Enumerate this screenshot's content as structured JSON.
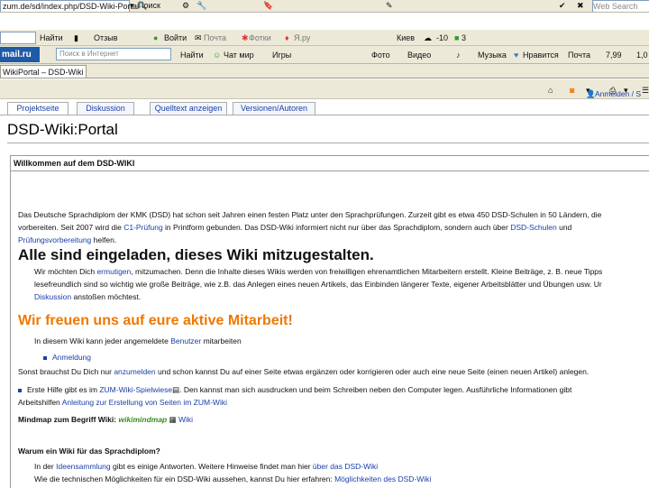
{
  "toolbar1": {
    "address": "zum.de/sd/index.php/DSD-Wiki-Portal",
    "search_label": "Поиск",
    "web_search": "Web Search"
  },
  "toolbar2": {
    "find": "Найти",
    "feedback": "Отзыв",
    "login": "Войти",
    "mail": "Почта",
    "photo": "Фотки",
    "ya": "Я.ру",
    "city": "Киев",
    "weather": "-10",
    "traffic": "3"
  },
  "toolbar3": {
    "brand": "mail.ru",
    "search_placeholder": "Поиск в Интернет",
    "find": "Найти",
    "agent": "Чат мир",
    "games": "Игры",
    "photo": "Фото",
    "video": "Видео",
    "music": "Музыка",
    "like": "Нравится",
    "mail": "Почта",
    "price": "7,99",
    "more": "1,0"
  },
  "browser_tab": {
    "label": "WikiPortal – DSD-Wiki"
  },
  "account": {
    "login": "Anmelden / S"
  },
  "wiki_tabs": [
    {
      "label": "Projektseite"
    },
    {
      "label": "Diskussion"
    },
    {
      "label": "Quelltext anzeigen"
    },
    {
      "label": "Versionen/Autoren"
    }
  ],
  "page": {
    "title": "DSD-Wiki:Portal",
    "box_title": "Willkommen auf dem DSD-WIKI",
    "intro1": "Das Deutsche Sprachdiplom der KMK (DSD) hat schon seit Jahren einen festen Platz unter den Sprachprüfungen. Zurzeit gibt es etwa 450 DSD-Schulen in 50 Ländern, die",
    "intro2a": "vorbereiten. Seit 2007 wird die",
    "intro2b": "C1-Prüfung",
    "intro2c": "in Printform gebunden. Das DSD-Wiki informiert nicht nur über das Sprachdiplom, sondern auch über",
    "intro2d": "DSD-Schulen",
    "intro2e": "und",
    "intro3a": "Prüfungsvorbereitung",
    "intro3b": "helfen.",
    "heading1": "Alle sind eingeladen, dieses Wiki mitzugestalten.",
    "invite1a": "Wir möchten Dich",
    "invite1b": "ermutigen",
    "invite1c": ", mitzumachen. Denn die Inhalte dieses Wikis werden von freiwilligen ehrenamtlichen Mitarbeitern erstellt. Kleine Beiträge, z. B. neue Tipps",
    "invite2": "lesefreundlich sind so wichtig wie große Beiträge, wie z.B. das Anlegen eines neuen Artikels, das Einbinden längerer Texte, eigener Arbeitsblätter und Übungen usw. Ur",
    "invite3a": "Diskussion",
    "invite3b": "anstoßen möchtest.",
    "heading2": "Wir freuen uns auf eure aktive Mitarbeit!",
    "collab1a": "In diesem Wiki kann jeder angemeldete",
    "collab1b": "Benutzer",
    "collab1c": "mitarbeiten",
    "collab2": "Anmeldung",
    "collab3a": "Sonst brauchst Du Dich nur",
    "collab3b": "anzumelden",
    "collab3c": "und schon kannst Du auf einer Seite etwas ergänzen oder korrigieren oder auch eine neue Seite (einen neuen Artikel) anlegen.",
    "help1a": "Erste Hilfe gibt es im",
    "help1b": "ZUM-Wiki-Spielwiese",
    "help1c": ". Den kannst man sich ausdrucken und beim Schreiben neben den Computer legen. Ausführliche Informationen gibt",
    "help2a": "Arbeitshilfen",
    "help2b": "Anleitung zur Erstellung von Seiten im ZUM-Wiki",
    "mindmap_label": "Mindmap zum Begriff Wiki:",
    "mindmap_logo": "wikimindmap",
    "mindmap_link": "Wiki",
    "why_label": "Warum ein Wiki für das Sprachdiplom?",
    "why1a": "In der",
    "why1b": "Ideensammlung",
    "why1c": "gibt es einige Antworten. Weitere Hinweise findet man hier",
    "why1d": "über das DSD-Wiki",
    "why2a": "Wie die technischen Möglichkeiten für ein DSD-Wiki aussehen, kannst Du hier erfahren:",
    "why2b": "Möglichkeiten des DSD-Wiki"
  },
  "colors": {
    "orange_heading": "#f07800",
    "link": "#1a3fa8",
    "mailru": "#1e5aa8"
  }
}
